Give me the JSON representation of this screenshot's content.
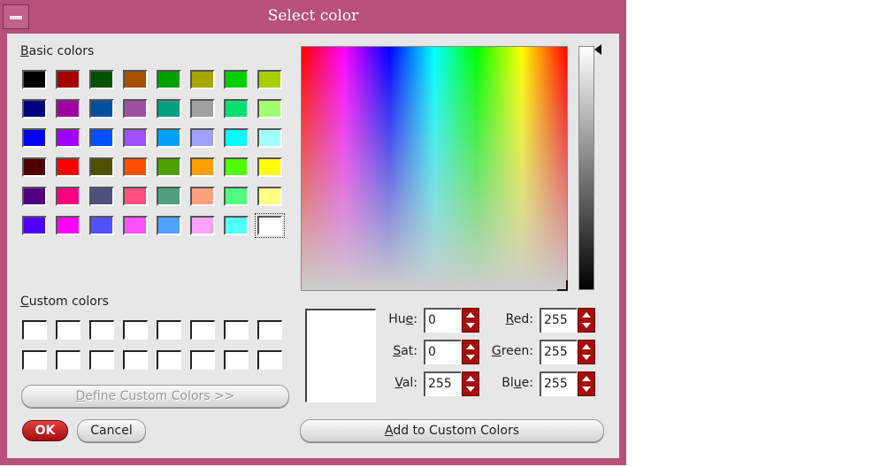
{
  "window": {
    "title": "Select color"
  },
  "basic_colors": {
    "label_accel": "B",
    "label_rest": "asic colors",
    "swatches": [
      [
        "#000000",
        "#a40000",
        "#005100",
        "#a65000",
        "#00a100",
        "#a6a600",
        "#00d000",
        "#a6d000"
      ],
      [
        "#000080",
        "#a000a0",
        "#0050a0",
        "#a050a0",
        "#00a080",
        "#a0a0a0",
        "#00e070",
        "#a0ff70"
      ],
      [
        "#0000ff",
        "#a000ff",
        "#0050ff",
        "#a050ff",
        "#00a0ff",
        "#a0a0ff",
        "#00ffff",
        "#a0ffff"
      ],
      [
        "#500000",
        "#ff0000",
        "#505000",
        "#ff5000",
        "#50a000",
        "#ffa000",
        "#50ff00",
        "#ffff00"
      ],
      [
        "#500080",
        "#ff0080",
        "#505080",
        "#ff5080",
        "#50a080",
        "#ffa080",
        "#50ff80",
        "#ffff80"
      ],
      [
        "#5000ff",
        "#ff00ff",
        "#5050ff",
        "#ff50ff",
        "#50a0ff",
        "#ffa0ff",
        "#50ffff",
        "#ffffff"
      ]
    ],
    "selected_index": [
      5,
      7
    ]
  },
  "custom_colors": {
    "label_accel": "C",
    "label_rest": "ustom colors",
    "rows": 2,
    "cols": 8,
    "color": "#ffffff"
  },
  "buttons": {
    "define_custom_pre": "D",
    "define_custom_rest": "efine Custom Colors >>",
    "ok": "OK",
    "cancel": "Cancel",
    "add_custom_accel": "A",
    "add_custom_rest": "dd to Custom Colors"
  },
  "fields": {
    "hue": {
      "pre": "Hu",
      "accel": "e",
      "post": ":",
      "value": "0"
    },
    "sat": {
      "pre": "",
      "accel": "S",
      "post": "at:",
      "value": "0"
    },
    "val": {
      "pre": "",
      "accel": "V",
      "post": "al:",
      "value": "255"
    },
    "red": {
      "pre": "",
      "accel": "R",
      "post": "ed:",
      "value": "255"
    },
    "green": {
      "pre": "",
      "accel": "G",
      "post": "reen:",
      "value": "255"
    },
    "blue": {
      "pre": "Bl",
      "accel": "u",
      "post": "e:",
      "value": "255"
    }
  },
  "preview_color": "#ffffff",
  "colors": {
    "titlebar": "#b8507c",
    "ok_button": "#c01515",
    "spin_arrows": "#a80d0d"
  }
}
